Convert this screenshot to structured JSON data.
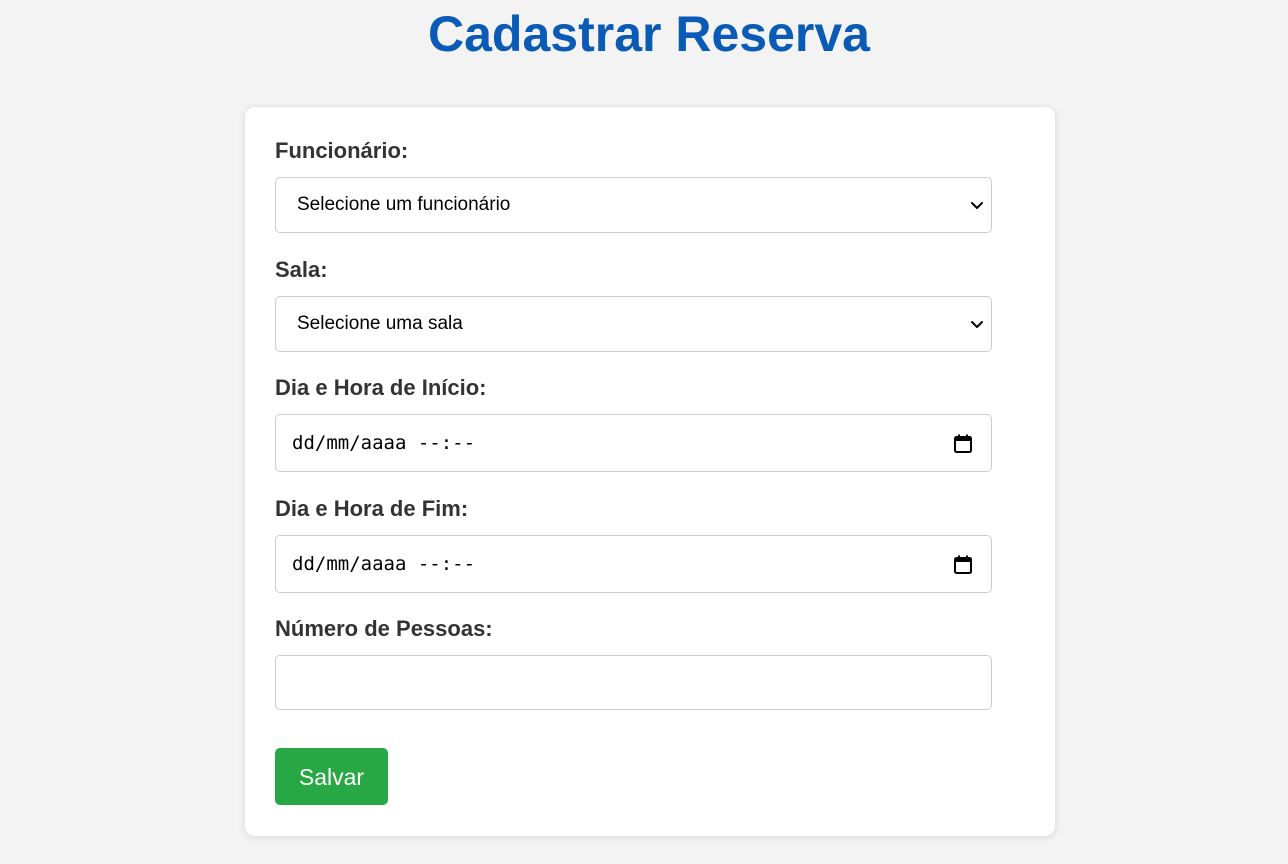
{
  "page": {
    "title": "Cadastrar Reserva"
  },
  "form": {
    "funcionario": {
      "label": "Funcionário:",
      "selected": "Selecione um funcionário"
    },
    "sala": {
      "label": "Sala:",
      "selected": "Selecione uma sala"
    },
    "inicio": {
      "label": "Dia e Hora de Início:",
      "value_placeholder": "dd/mm/aaaa --:--"
    },
    "fim": {
      "label": "Dia e Hora de Fim:",
      "value_placeholder": "dd/mm/aaaa --:--"
    },
    "pessoas": {
      "label": "Número de Pessoas:",
      "value": ""
    },
    "submit_label": "Salvar"
  },
  "colors": {
    "background": "#f3f3f3",
    "title": "#0a5bb5",
    "label": "#333333",
    "button": "#28a745",
    "button_text": "#ffffff"
  },
  "icons": {
    "select_indicator": "chevron-down-icon",
    "datetime_picker": "calendar-icon"
  }
}
